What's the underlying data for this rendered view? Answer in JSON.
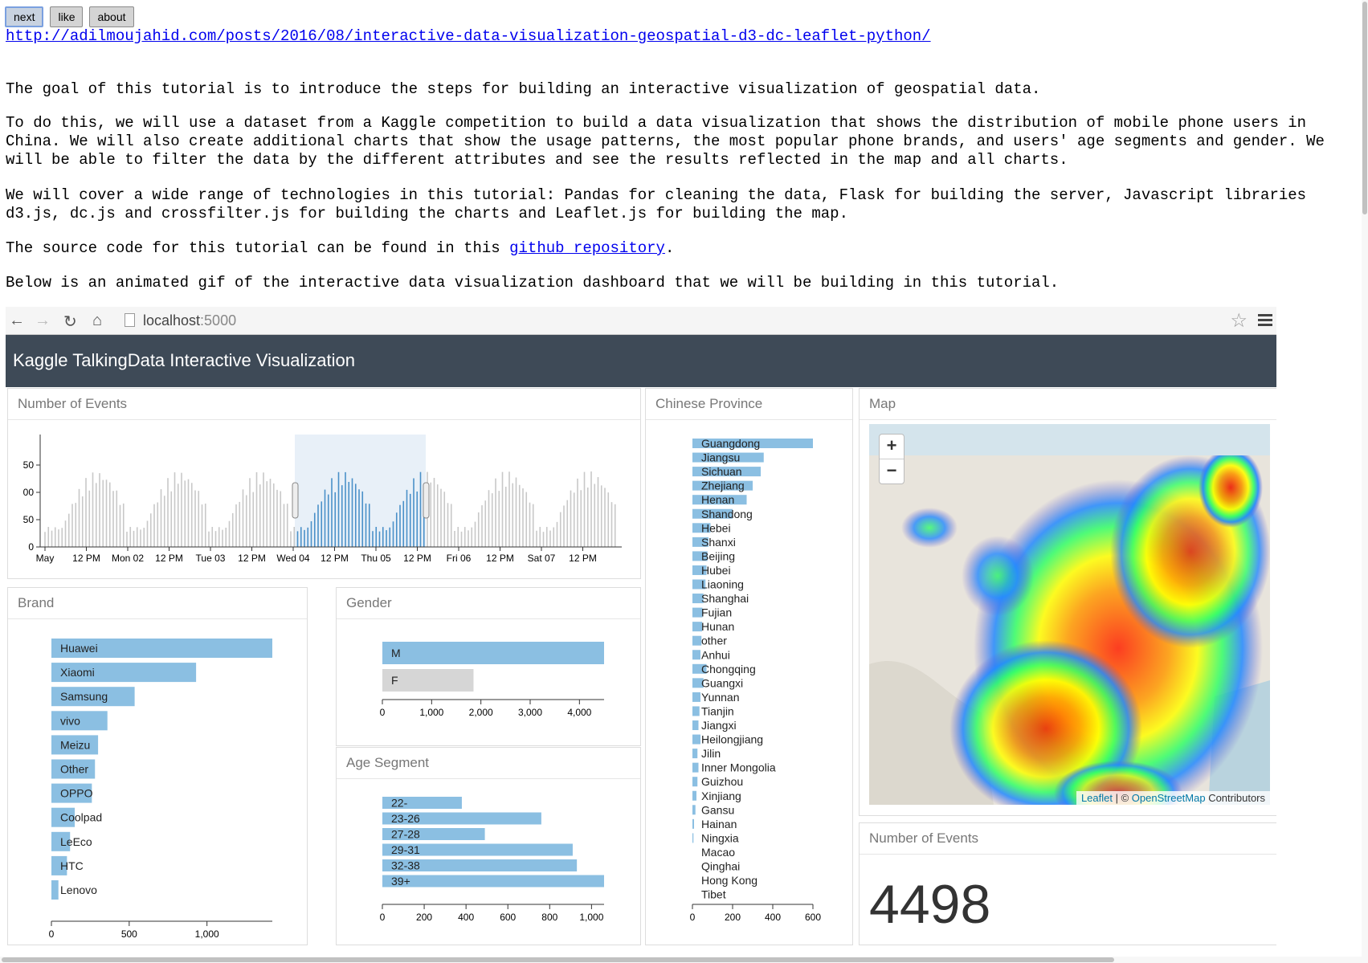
{
  "nav": {
    "next": "next",
    "like": "like",
    "about": "about"
  },
  "url": "http://adilmoujahid.com/posts/2016/08/interactive-data-visualization-geospatial-d3-dc-leaflet-python/",
  "paragraphs": {
    "p1": "The goal of this tutorial is to introduce the steps for building an interactive visualization of geospatial data.",
    "p2": "To do this, we will use a dataset from a Kaggle competition to build a data visualization that shows the distribution of mobile phone users in China. We will also create additional charts that show the usage patterns, the most popular phone brands, and users' age segments and gender. We will be able to filter the data by the different attributes and see the results reflected in the map and all charts.",
    "p3": "We will cover a wide range of technologies in this tutorial: Pandas for cleaning the data, Flask for building the server, Javascript libraries d3.js, dc.js and crossfilter.js for building the charts and Leaflet.js for building the map.",
    "p4_before": "The source code for this tutorial can be found in this ",
    "p4_link": "github repository",
    "p4_after": ".",
    "p5": "Below is an animated gif of the interactive data visualization dashboard that we will be building in this tutorial."
  },
  "browser": {
    "address_host": "localhost",
    "address_port": ":5000"
  },
  "dashboard": {
    "title": "Kaggle TalkingData Interactive Visualization",
    "events_title": "Number of Events",
    "brand_title": "Brand",
    "gender_title": "Gender",
    "age_title": "Age Segment",
    "province_title": "Chinese Province",
    "map_title": "Map",
    "count_title": "Number of Events",
    "count_value": "4498",
    "zoom_in": "+",
    "zoom_out": "−",
    "attribution": {
      "leaflet": "Leaflet",
      "sep": " | © ",
      "osm": "OpenStreetMap",
      "contrib": " Contributors"
    }
  },
  "chart_data": [
    {
      "type": "bar",
      "title": "Number of Events",
      "x_tick_labels": [
        "May",
        "12 PM",
        "Mon 02",
        "12 PM",
        "Tue 03",
        "12 PM",
        "Wed 04",
        "12 PM",
        "Thu 05",
        "12 PM",
        "Fri 06",
        "12 PM",
        "Sat 07",
        "12 PM"
      ],
      "y_tick_labels": [
        "0",
        "50",
        "00",
        "50"
      ],
      "selected_range": [
        "Wed 04",
        "12 PM (Thu 05)"
      ]
    },
    {
      "type": "bar",
      "title": "Brand",
      "categories": [
        "Huawei",
        "Xiaomi",
        "Samsung",
        "vivo",
        "Meizu",
        "Other",
        "OPPO",
        "Coolpad",
        "LeEco",
        "HTC",
        "Lenovo"
      ],
      "values": [
        1420,
        930,
        535,
        360,
        300,
        280,
        260,
        150,
        120,
        100,
        45
      ],
      "xlim": [
        0,
        1420
      ],
      "x_ticks": [
        "0",
        "500",
        "1,000"
      ]
    },
    {
      "type": "bar",
      "title": "Gender",
      "categories": [
        "M",
        "F"
      ],
      "values": [
        4500,
        1850
      ],
      "xlim": [
        0,
        4500
      ],
      "x_ticks": [
        "0",
        "1,000",
        "2,000",
        "3,000",
        "4,000"
      ]
    },
    {
      "type": "bar",
      "title": "Age Segment",
      "categories": [
        "22-",
        "23-26",
        "27-28",
        "29-31",
        "32-38",
        "39+"
      ],
      "values": [
        380,
        760,
        490,
        910,
        930,
        1060
      ],
      "xlim": [
        0,
        1060
      ],
      "x_ticks": [
        "0",
        "200",
        "400",
        "600",
        "800",
        "1,000"
      ]
    },
    {
      "type": "bar",
      "title": "Chinese Province",
      "categories": [
        "Guangdong",
        "Jiangsu",
        "Sichuan",
        "Zhejiang",
        "Henan",
        "Shandong",
        "Hebei",
        "Shanxi",
        "Beijing",
        "Hubei",
        "Liaoning",
        "Shanghai",
        "Fujian",
        "Hunan",
        "other",
        "Anhui",
        "Chongqing",
        "Guangxi",
        "Yunnan",
        "Tianjin",
        "Jiangxi",
        "Heilongjiang",
        "Jilin",
        "Inner Mongolia",
        "Guizhou",
        "Xinjiang",
        "Gansu",
        "Hainan",
        "Ningxia",
        "Macao",
        "Qinghai",
        "Hong Kong",
        "Tibet"
      ],
      "values": [
        600,
        355,
        340,
        300,
        270,
        200,
        90,
        80,
        75,
        70,
        65,
        55,
        50,
        48,
        45,
        40,
        70,
        55,
        40,
        35,
        30,
        40,
        25,
        30,
        25,
        20,
        15,
        8,
        5,
        0,
        0,
        0,
        0
      ],
      "xlim": [
        0,
        600
      ],
      "x_ticks": [
        "0",
        "200",
        "400",
        "600"
      ]
    }
  ]
}
